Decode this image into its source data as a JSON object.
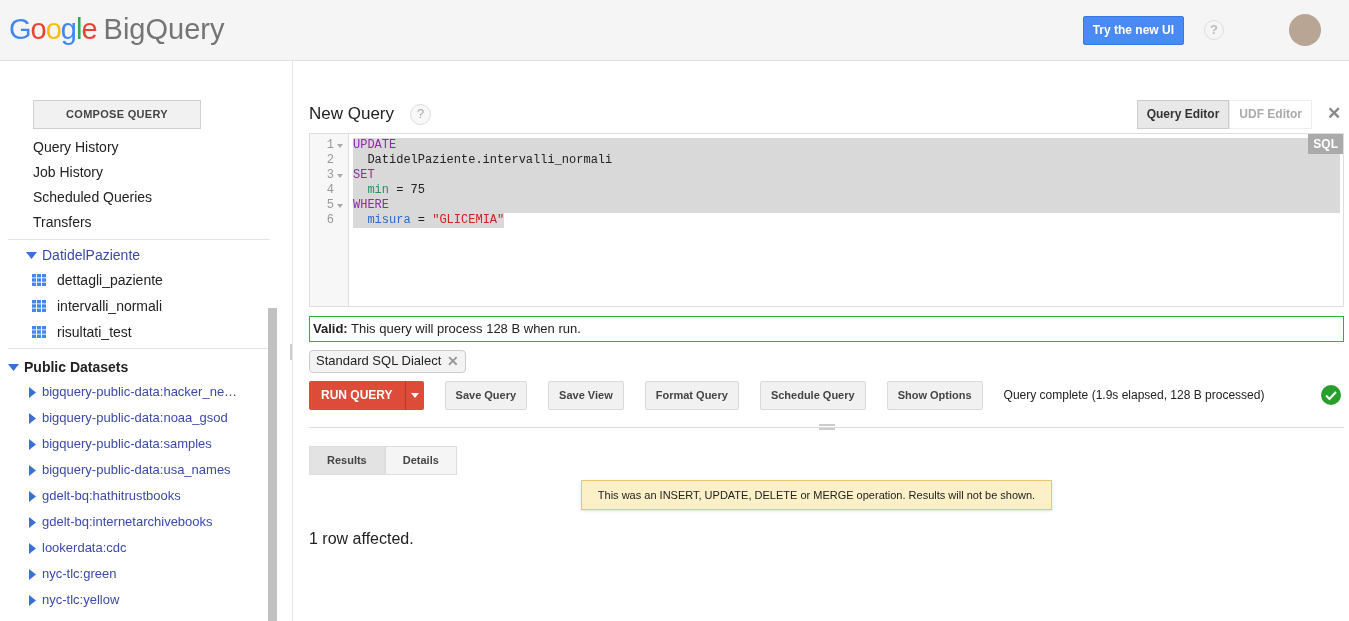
{
  "header": {
    "logo_google": "Google",
    "logo_product": "BigQuery",
    "new_ui_button": "Try the new UI",
    "help": "?"
  },
  "sidebar": {
    "compose_button": "COMPOSE QUERY",
    "links": [
      "Query History",
      "Job History",
      "Scheduled Queries",
      "Transfers"
    ],
    "projects": [
      {
        "label": "DatidelPaziente",
        "expanded": true,
        "kind": "project",
        "children": [
          {
            "label": "dettagli_paziente",
            "kind": "table"
          },
          {
            "label": "intervalli_normali",
            "kind": "table"
          },
          {
            "label": "risultati_test",
            "kind": "table"
          }
        ]
      },
      {
        "label": "Public Datasets",
        "expanded": true,
        "kind": "section",
        "children": [
          {
            "label": "bigquery-public-data:hacker_ne…",
            "kind": "dataset",
            "expanded": false
          },
          {
            "label": "bigquery-public-data:noaa_gsod",
            "kind": "dataset",
            "expanded": false
          },
          {
            "label": "bigquery-public-data:samples",
            "kind": "dataset",
            "expanded": false
          },
          {
            "label": "bigquery-public-data:usa_names",
            "kind": "dataset",
            "expanded": false
          },
          {
            "label": "gdelt-bq:hathitrustbooks",
            "kind": "dataset",
            "expanded": false
          },
          {
            "label": "gdelt-bq:internetarchivebooks",
            "kind": "dataset",
            "expanded": false
          },
          {
            "label": "lookerdata:cdc",
            "kind": "dataset",
            "expanded": false
          },
          {
            "label": "nyc-tlc:green",
            "kind": "dataset",
            "expanded": false
          },
          {
            "label": "nyc-tlc:yellow",
            "kind": "dataset",
            "expanded": false
          }
        ]
      }
    ]
  },
  "query": {
    "title": "New Query",
    "help": "?",
    "editor_tabs": [
      {
        "label": "Query Editor",
        "selected": true
      },
      {
        "label": "UDF Editor",
        "selected": false
      }
    ],
    "close": "✕",
    "language_badge": "SQL",
    "lines": [
      {
        "number": "1",
        "foldable": true,
        "selected": true,
        "tokens": [
          {
            "text": "UPDATE",
            "kind": "keyword"
          }
        ]
      },
      {
        "number": "2",
        "foldable": false,
        "selected": true,
        "tokens": [
          {
            "text": "  DatidelPaziente.intervalli_normali",
            "kind": "plain"
          }
        ]
      },
      {
        "number": "3",
        "foldable": true,
        "selected": true,
        "tokens": [
          {
            "text": "SET",
            "kind": "keyword"
          }
        ]
      },
      {
        "number": "4",
        "foldable": false,
        "selected": true,
        "tokens": [
          {
            "text": "  min",
            "kind": "function"
          },
          {
            "text": " = 75",
            "kind": "plain"
          }
        ]
      },
      {
        "number": "5",
        "foldable": true,
        "selected": true,
        "tokens": [
          {
            "text": "WHERE",
            "kind": "keyword"
          }
        ]
      },
      {
        "number": "6",
        "foldable": false,
        "selected": true,
        "tokens": [
          {
            "text": "  misura",
            "kind": "field"
          },
          {
            "text": " = ",
            "kind": "plain"
          },
          {
            "text": "\"GLICEMIA\"",
            "kind": "string"
          }
        ]
      }
    ],
    "validation": "**Valid:** This query will process 128 B when run.",
    "dialect_chip": "Standard SQL Dialect",
    "dialect_remove": "✕",
    "run_button": "RUN QUERY",
    "buttons": [
      "Save Query",
      "Save View",
      "Format Query",
      "Schedule Query",
      "Show Options"
    ],
    "status": "Query complete (1.9s elapsed, 128 B processed)",
    "result_tabs": [
      {
        "label": "Results",
        "selected": true
      },
      {
        "label": "Details",
        "selected": false
      }
    ],
    "notice": "This was an INSERT, UPDATE, DELETE or MERGE operation. Results will not be shown.",
    "affected": "1 row affected."
  }
}
